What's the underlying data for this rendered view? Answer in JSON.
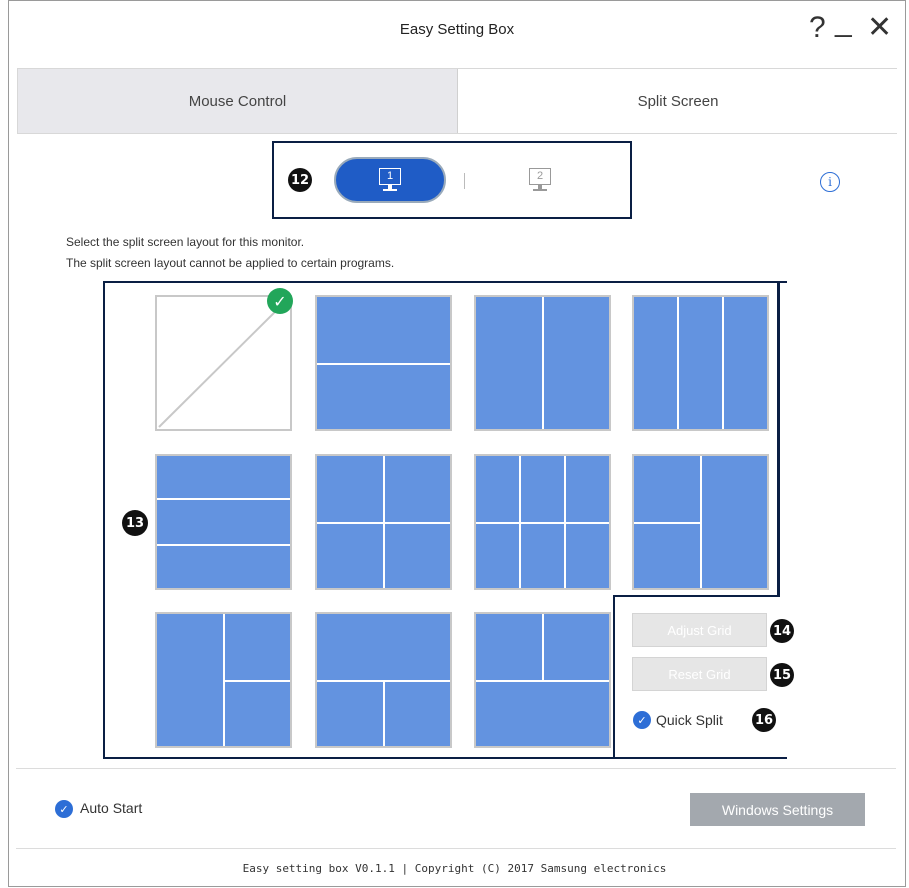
{
  "window": {
    "title": "Easy Setting Box",
    "help_glyph": "?",
    "minimize_glyph": "_",
    "close_glyph": "✕"
  },
  "tabs": [
    {
      "label": "Mouse Control",
      "active": false
    },
    {
      "label": "Split Screen",
      "active": true
    }
  ],
  "monitors": {
    "callout": "12",
    "items": [
      {
        "number": "1",
        "selected": true
      },
      {
        "number": "2",
        "selected": false
      }
    ]
  },
  "description": {
    "line1": "Select the split screen layout for this monitor.",
    "line2": "The split screen layout cannot be applied to certain programs."
  },
  "layouts": {
    "callout": "13",
    "selected_index": 0,
    "items": [
      "none",
      "two-horizontal",
      "two-vertical",
      "three-vertical",
      "three-horizontal",
      "four-grid",
      "six-grid",
      "left-two-right-one",
      "left-one-right-two",
      "top-one-bottom-two",
      "top-two-bottom-one"
    ]
  },
  "side_controls": {
    "adjust_grid": {
      "label": "Adjust Grid",
      "callout": "14"
    },
    "reset_grid": {
      "label": "Reset Grid",
      "callout": "15"
    },
    "quick_split": {
      "label": "Quick Split",
      "checked": true,
      "callout": "16"
    }
  },
  "bottom": {
    "auto_start": {
      "label": "Auto Start",
      "checked": true
    },
    "windows_settings_label": "Windows Settings"
  },
  "footer": "Easy setting box V0.1.1 | Copyright (C) 2017 Samsung electronics",
  "icons": {
    "check": "✓",
    "info": "i"
  },
  "colors": {
    "accent_blue": "#1f5cc6",
    "layout_fill": "#6393e0",
    "check_green": "#22a65a",
    "frame_navy": "#0a1f44"
  }
}
